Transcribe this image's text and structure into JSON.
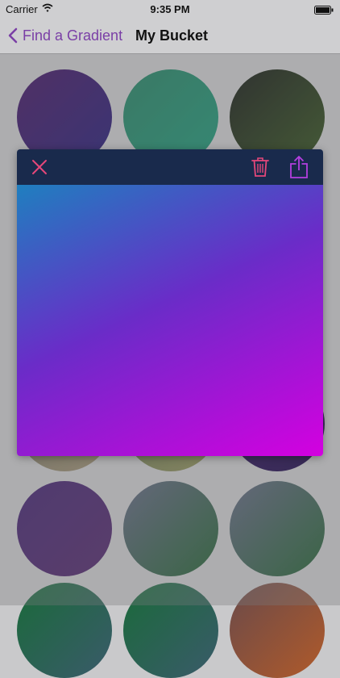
{
  "status_bar": {
    "carrier": "Carrier",
    "time": "9:35 PM",
    "wifi_icon": "wifi-icon",
    "battery_icon": "battery-icon"
  },
  "nav": {
    "back_label": "Find a Gradient",
    "title": "My Bucket",
    "accent_color": "#7a3fa6"
  },
  "modal": {
    "icons": [
      "close-icon",
      "trash-icon",
      "share-icon"
    ],
    "close_color": "#e5477a",
    "trash_color": "#e5477a",
    "share_color": "#b43fe0",
    "header_color": "#192a4c",
    "gradient": {
      "from": "#1f7fbf",
      "to": "#d400e0"
    }
  },
  "gradients": [
    {
      "from": "#3b0a5a",
      "to": "#1a1170"
    },
    {
      "from": "#1a7a5a",
      "to": "#12906f"
    },
    {
      "from": "#0a0f0a",
      "to": "#2a4a12"
    },
    {
      "from": "#6a6a5a",
      "to": "#9a8a6a"
    },
    {
      "from": "#5a6a4a",
      "to": "#8a8a50"
    },
    {
      "from": "#2a0a5a",
      "to": "#130040"
    },
    {
      "from": "#3a1a6a",
      "to": "#4a1f63"
    },
    {
      "from": "#5a5f7a",
      "to": "#1a5a2a"
    },
    {
      "from": "#5a5f7a",
      "to": "#1a5a2a"
    },
    {
      "from": "#1a6a3a",
      "to": "#3a5a6a"
    },
    {
      "from": "#1a6a3a",
      "to": "#3a5a6a"
    },
    {
      "from": "#6a4a4a",
      "to": "#b05a2a"
    }
  ]
}
